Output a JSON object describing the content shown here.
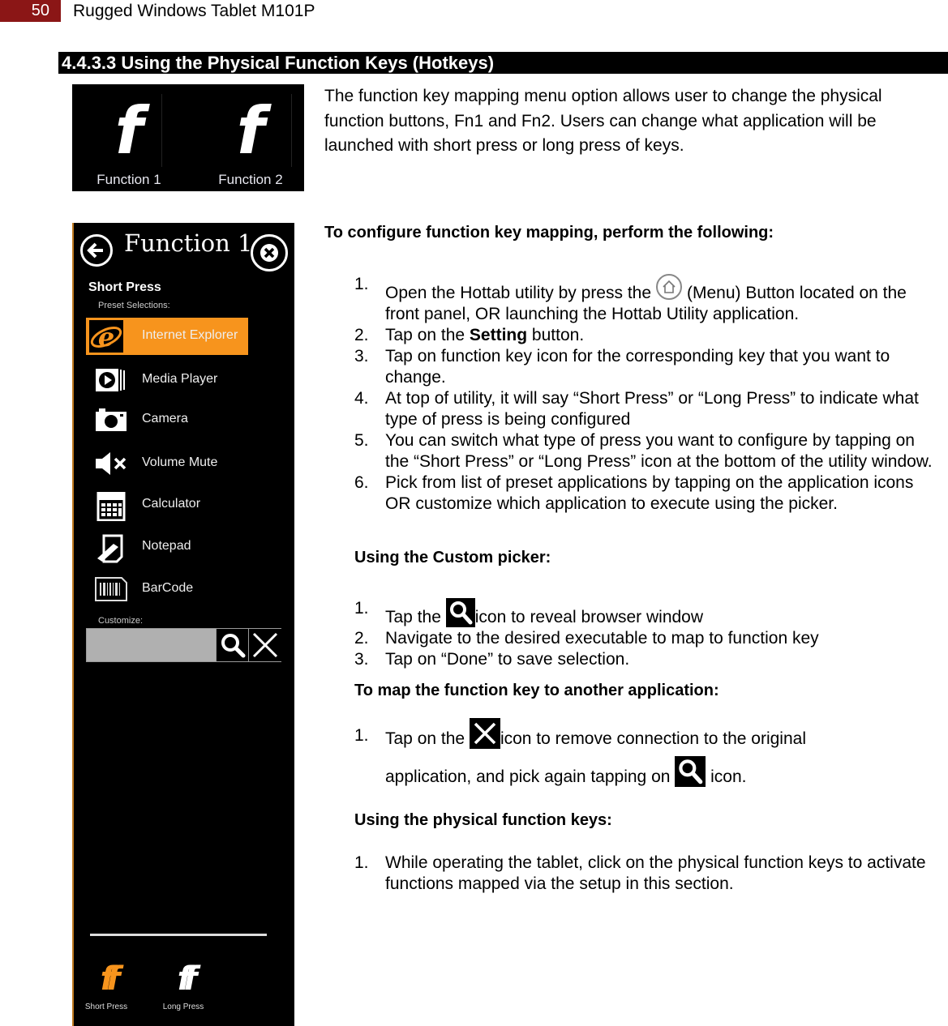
{
  "header": {
    "page_number": "50",
    "doc_title": "Rugged Windows Tablet M101P",
    "accent_color": "#8b1616"
  },
  "section": {
    "title": "4.4.3.3 Using the Physical Function Keys (Hotkeys)"
  },
  "function_keys_image": {
    "keys": [
      {
        "glyph": "f",
        "label": "Function 1"
      },
      {
        "glyph": "f",
        "label": "Function 2"
      }
    ]
  },
  "intro": "The function key mapping menu option allows user to change the physical function buttons, Fn1 and Fn2. Users can change what application will be launched with short press or long press of keys.",
  "configure": {
    "heading": "To configure function key mapping, perform the following:",
    "steps": [
      {
        "n": "1.",
        "before": "Open the Hottab utility by press the",
        "icon": "home-button-icon",
        "after": "(Menu) Button located on the front panel, OR launching the Hottab Utility application."
      },
      {
        "n": "2.",
        "before": "Tap on the ",
        "bold": "Setting",
        "after": " button."
      },
      {
        "n": "3.",
        "text": "Tap on function key icon for the corresponding key that you want to change."
      },
      {
        "n": "4.",
        "text": "At top of utility, it will say “Short Press” or “Long Press” to indicate what type of press is being configured"
      },
      {
        "n": "5.",
        "text": "You can switch what type of press you want to configure by tapping on the “Short Press” or “Long Press” icon at the bottom of the utility window."
      },
      {
        "n": "6.",
        "text": "Pick from list of preset applications by tapping on the application icons OR customize which application to execute using the picker."
      }
    ]
  },
  "custom_picker": {
    "heading": "Using the Custom picker:",
    "steps": [
      {
        "n": "1.",
        "before": "Tap the",
        "icon": "search-icon",
        "after": "icon to reveal browser window"
      },
      {
        "n": "2.",
        "text": "Navigate to the desired executable to map to function key"
      },
      {
        "n": "3.",
        "text": "Tap on “Done” to save selection."
      }
    ]
  },
  "remap": {
    "heading": "To map the function key to another application:",
    "step": {
      "n": "1.",
      "part1": " Tap on the",
      "icon1": "close-icon",
      "part2": "icon to remove connection to the original",
      "part3": "application, and pick again tapping on",
      "icon2": "search-icon",
      "part4": "icon."
    }
  },
  "physical_keys": {
    "heading": "Using the physical function keys:",
    "steps": [
      {
        "n": "1.",
        "text": "While operating the tablet, click on the physical function keys to activate functions mapped via the setup in this section."
      }
    ]
  },
  "app_screenshot": {
    "title": "Function 1",
    "press_type": "Short Press",
    "preset_label": "Preset Selections:",
    "selected_color": "#f7941d",
    "presets": [
      {
        "label": "Internet Explorer",
        "icon": "internet-explorer-icon",
        "selected": true
      },
      {
        "label": "Media Player",
        "icon": "media-player-icon",
        "selected": false
      },
      {
        "label": "Camera",
        "icon": "camera-icon",
        "selected": false
      },
      {
        "label": "Volume Mute",
        "icon": "volume-mute-icon",
        "selected": false
      },
      {
        "label": "Calculator",
        "icon": "calculator-icon",
        "selected": false
      },
      {
        "label": "Notepad",
        "icon": "notepad-icon",
        "selected": false
      },
      {
        "label": "BarCode",
        "icon": "barcode-icon",
        "selected": false
      }
    ],
    "customize_label": "Customize:",
    "customize_value": "",
    "bottom_buttons": [
      {
        "glyph": "ff",
        "label": "Short Press",
        "active": true
      },
      {
        "glyph": "ff",
        "label": "Long Press",
        "active": false
      }
    ]
  }
}
